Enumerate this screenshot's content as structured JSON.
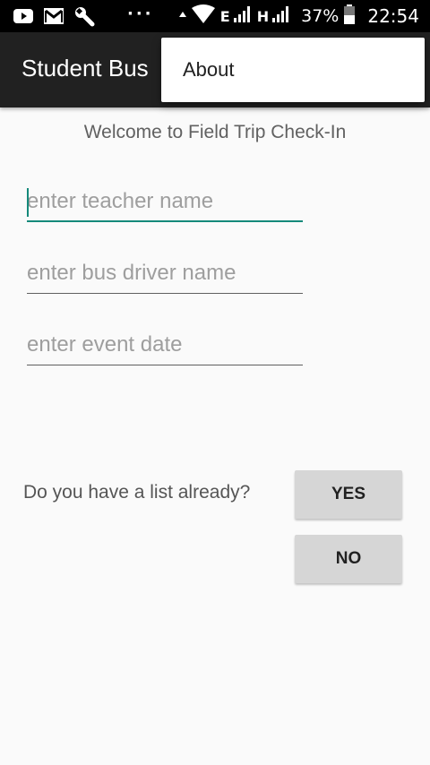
{
  "status_bar": {
    "network_type_1": "E",
    "network_type_2": "H",
    "battery_percent": "37%",
    "time": "22:54",
    "icons": [
      "youtube-icon",
      "gmail-icon",
      "wrench-icon",
      "more-dots-icon",
      "wifi-icon",
      "signal-icon",
      "battery-icon"
    ]
  },
  "app_bar": {
    "title": "Student Bus"
  },
  "overflow_menu": {
    "items": [
      {
        "label": "About"
      }
    ]
  },
  "main": {
    "welcome": "Welcome to Field Trip Check-In",
    "fields": {
      "teacher": {
        "value": "",
        "placeholder": "enter teacher name"
      },
      "driver": {
        "value": "",
        "placeholder": "enter bus driver name"
      },
      "date": {
        "value": "",
        "placeholder": "enter event date"
      }
    },
    "question": "Do you have a list already?",
    "yes_label": "YES",
    "no_label": "NO"
  },
  "colors": {
    "accent": "#15897a",
    "app_bar": "#212121",
    "button": "#d6d6d6",
    "background": "#fafafa"
  }
}
